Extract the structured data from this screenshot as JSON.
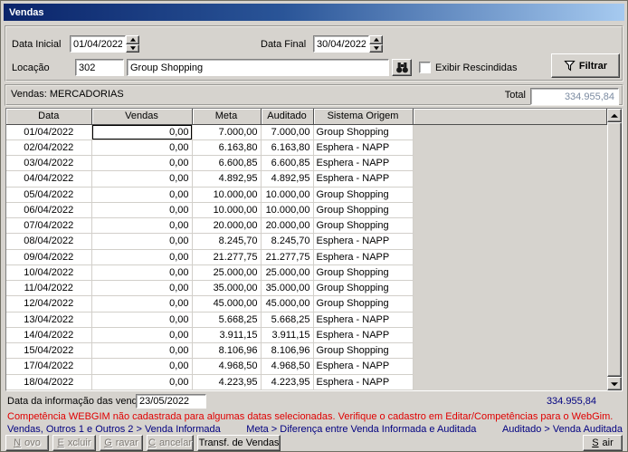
{
  "window": {
    "title": "Vendas"
  },
  "filters": {
    "data_inicial": {
      "label": "Data Inicial",
      "value": "01/04/2022"
    },
    "data_final": {
      "label": "Data Final",
      "value": "30/04/2022"
    },
    "locacao": {
      "label": "Locação",
      "code": "302",
      "name": "Group Shopping"
    },
    "exibir_rescindidas": {
      "label": "Exibir Rescindidas",
      "checked": false
    },
    "filtrar_label": "Filtrar"
  },
  "summary": {
    "vendas_label": "Vendas: MERCADORIAS",
    "total_label": "Total",
    "total_value": "334.955,84"
  },
  "table": {
    "columns": [
      "Data",
      "Vendas",
      "Meta",
      "Auditado",
      "Sistema Origem"
    ],
    "selected_cell": {
      "row": 0,
      "column": 1
    },
    "rows": [
      [
        "01/04/2022",
        "0,00",
        "7.000,00",
        "7.000,00",
        "Group Shopping"
      ],
      [
        "02/04/2022",
        "0,00",
        "6.163,80",
        "6.163,80",
        "Esphera - NAPP"
      ],
      [
        "03/04/2022",
        "0,00",
        "6.600,85",
        "6.600,85",
        "Esphera - NAPP"
      ],
      [
        "04/04/2022",
        "0,00",
        "4.892,95",
        "4.892,95",
        "Esphera - NAPP"
      ],
      [
        "05/04/2022",
        "0,00",
        "10.000,00",
        "10.000,00",
        "Group Shopping"
      ],
      [
        "06/04/2022",
        "0,00",
        "10.000,00",
        "10.000,00",
        "Group Shopping"
      ],
      [
        "07/04/2022",
        "0,00",
        "20.000,00",
        "20.000,00",
        "Group Shopping"
      ],
      [
        "08/04/2022",
        "0,00",
        "8.245,70",
        "8.245,70",
        "Esphera - NAPP"
      ],
      [
        "09/04/2022",
        "0,00",
        "21.277,75",
        "21.277,75",
        "Esphera - NAPP"
      ],
      [
        "10/04/2022",
        "0,00",
        "25.000,00",
        "25.000,00",
        "Group Shopping"
      ],
      [
        "11/04/2022",
        "0,00",
        "35.000,00",
        "35.000,00",
        "Group Shopping"
      ],
      [
        "12/04/2022",
        "0,00",
        "45.000,00",
        "45.000,00",
        "Group Shopping"
      ],
      [
        "13/04/2022",
        "0,00",
        "5.668,25",
        "5.668,25",
        "Esphera - NAPP"
      ],
      [
        "14/04/2022",
        "0,00",
        "3.911,15",
        "3.911,15",
        "Esphera - NAPP"
      ],
      [
        "15/04/2022",
        "0,00",
        "8.106,96",
        "8.106,96",
        "Group Shopping"
      ],
      [
        "17/04/2022",
        "0,00",
        "4.968,50",
        "4.968,50",
        "Esphera - NAPP"
      ],
      [
        "18/04/2022",
        "0,00",
        "4.223,95",
        "4.223,95",
        "Esphera - NAPP"
      ]
    ]
  },
  "footer": {
    "data_info_label": "Data da informação das vendas",
    "data_info_value": "23/05/2022",
    "total_value": "334.955,84",
    "warning": "Competência WEBGIM não cadastrada para algumas datas selecionadas. Verifique o cadastro em Editar/Competências para o WebGim.",
    "legend_vendas": "Vendas, Outros 1 e Outros 2 > Venda Informada",
    "legend_meta": "Meta > Diferença entre Venda Informada e Auditada",
    "legend_auditado": "Auditado > Venda Auditada"
  },
  "actions": {
    "novo": "Novo",
    "excluir": "Excluir",
    "gravar": "Gravar",
    "cancelar": "Cancelar",
    "transf_vendas": "Transf. de Vendas",
    "sair": "Sair"
  },
  "icons": {
    "locacao_search": "binoculars",
    "filtrar": "funnel",
    "spinners": "triangle-up-down",
    "scrollbar": "triangle-up-down"
  },
  "colors": {
    "window_bg": "#d6d3ce",
    "titlebar_gradient_start": "#0a246a",
    "titlebar_gradient_end": "#a6caf0",
    "warning_text": "#e00000",
    "legend_text": "#000080",
    "footer_total_text": "#000080",
    "total_box_text": "#7b8ba1"
  }
}
